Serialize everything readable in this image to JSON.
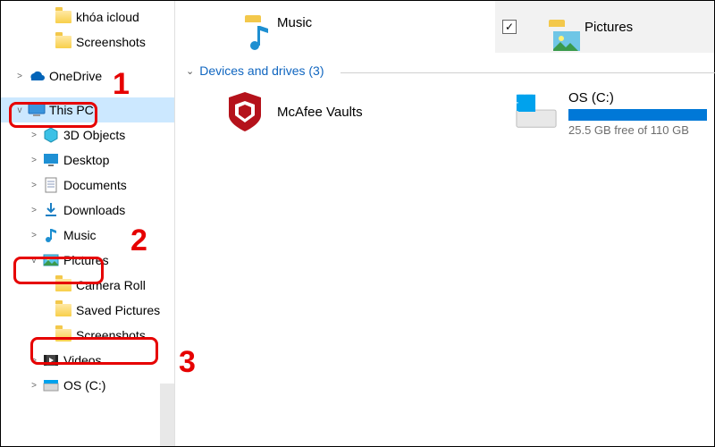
{
  "sidebar": {
    "items": [
      {
        "label": "khóa icloud",
        "indent": 3,
        "expander": "",
        "icon": "folder"
      },
      {
        "label": "Screenshots",
        "indent": 3,
        "expander": "",
        "icon": "folder"
      },
      {
        "label": "OneDrive",
        "indent": 1,
        "expander": ">",
        "icon": "onedrive"
      },
      {
        "label": "This PC",
        "indent": 1,
        "expander": "v",
        "icon": "thispc",
        "selected": true,
        "highlight": true
      },
      {
        "label": "3D Objects",
        "indent": 2,
        "expander": ">",
        "icon": "3d"
      },
      {
        "label": "Desktop",
        "indent": 2,
        "expander": ">",
        "icon": "desktop"
      },
      {
        "label": "Documents",
        "indent": 2,
        "expander": ">",
        "icon": "documents"
      },
      {
        "label": "Downloads",
        "indent": 2,
        "expander": ">",
        "icon": "downloads"
      },
      {
        "label": "Music",
        "indent": 2,
        "expander": ">",
        "icon": "music"
      },
      {
        "label": "Pictures",
        "indent": 2,
        "expander": "v",
        "icon": "pictures",
        "highlight": true
      },
      {
        "label": "Camera Roll",
        "indent": 3,
        "expander": "",
        "icon": "folder"
      },
      {
        "label": "Saved Pictures",
        "indent": 3,
        "expander": "",
        "icon": "folder"
      },
      {
        "label": "Screenshots",
        "indent": 3,
        "expander": "",
        "icon": "folder",
        "highlight": true
      },
      {
        "label": "Videos",
        "indent": 2,
        "expander": ">",
        "icon": "videos"
      },
      {
        "label": "OS (C:)",
        "indent": 2,
        "expander": ">",
        "icon": "drive"
      }
    ]
  },
  "annotations": {
    "step1": "1",
    "step2": "2",
    "step3": "3"
  },
  "main": {
    "music_label": "Music",
    "section_header": "Devices and drives (3)",
    "mcafee_label": "McAfee Vaults",
    "drive_label": "OS (C:)",
    "drive_free": "25.5 GB free of 110 GB"
  },
  "topright": {
    "label": "Pictures",
    "checked": true
  },
  "colors": {
    "annotation": "#e60000",
    "selection": "#cce8ff",
    "link": "#1066c0",
    "drive_bar": "#0078d7"
  }
}
